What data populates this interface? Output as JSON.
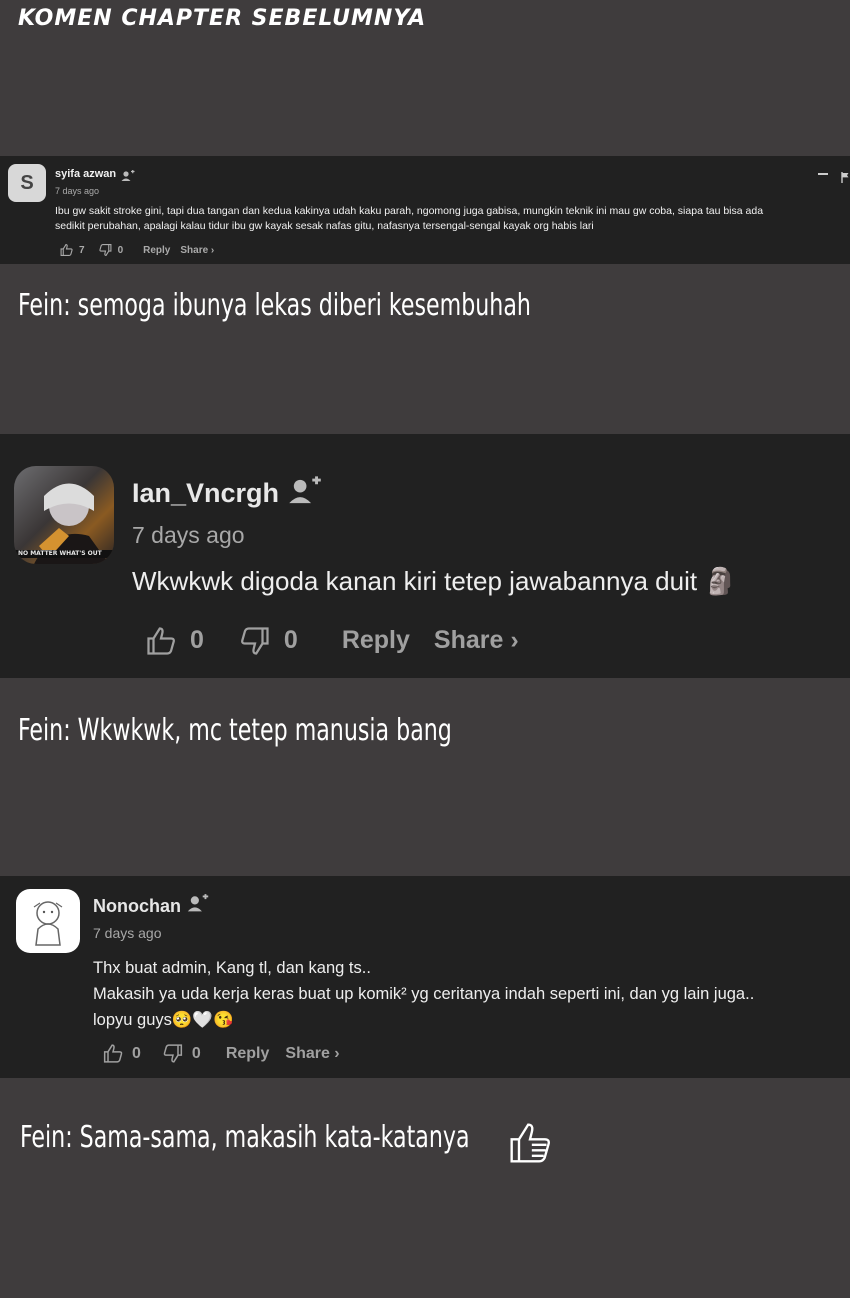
{
  "heading": "KOMEN CHAPTER SEBELUMNYA",
  "comments": [
    {
      "avatar_letter": "S",
      "username": "syifa azwan",
      "date": "7 days ago",
      "body_lines": [
        "Ibu gw sakit stroke gini, tapi dua tangan dan kedua kakinya udah kaku parah, ngomong juga gabisa, mungkin teknik ini mau gw coba, siapa tau bisa ada",
        "sedikit perubahan, apalagi kalau tidur ibu gw kayak sesak nafas gitu, nafasnya tersengal-sengal kayak org habis lari"
      ],
      "likes": "7",
      "dislikes": "0",
      "reply_label": "Reply",
      "share_label": "Share ›"
    },
    {
      "username": "Ian_Vncrgh",
      "date": "7 days ago",
      "avatar_caption": "NO MATTER WHAT'S OUT",
      "body_lines": [
        "Wkwkwk digoda kanan kiri tetep jawabannya duit 🗿"
      ],
      "likes": "0",
      "dislikes": "0",
      "reply_label": "Reply",
      "share_label": "Share ›"
    },
    {
      "username": "Nonochan",
      "date": "7 days ago",
      "body_lines": [
        "Thx buat admin, Kang tl, dan kang ts..",
        "Makasih ya uda kerja keras buat up komik² yg ceritanya indah seperti ini, dan yg lain juga..",
        "lopyu guys🥺🤍😘"
      ],
      "likes": "0",
      "dislikes": "0",
      "reply_label": "Reply",
      "share_label": "Share ›"
    }
  ],
  "replies": [
    "Fein: semoga ibunya lekas diberi kesembuhah",
    "Fein: Wkwkwk, mc tetep manusia bang",
    "Fein: Sama-sama, makasih kata-katanya"
  ],
  "icons": [
    "add-person-icon",
    "thumbs-up-icon",
    "thumbs-down-icon",
    "flag-icon",
    "minus-icon",
    "thumbs-up-outline-icon"
  ],
  "colors": {
    "page_bg": "#3f3c3d",
    "comment_bg": "#212121",
    "muted": "#aaaaaa",
    "text": "#f1f1f1"
  }
}
